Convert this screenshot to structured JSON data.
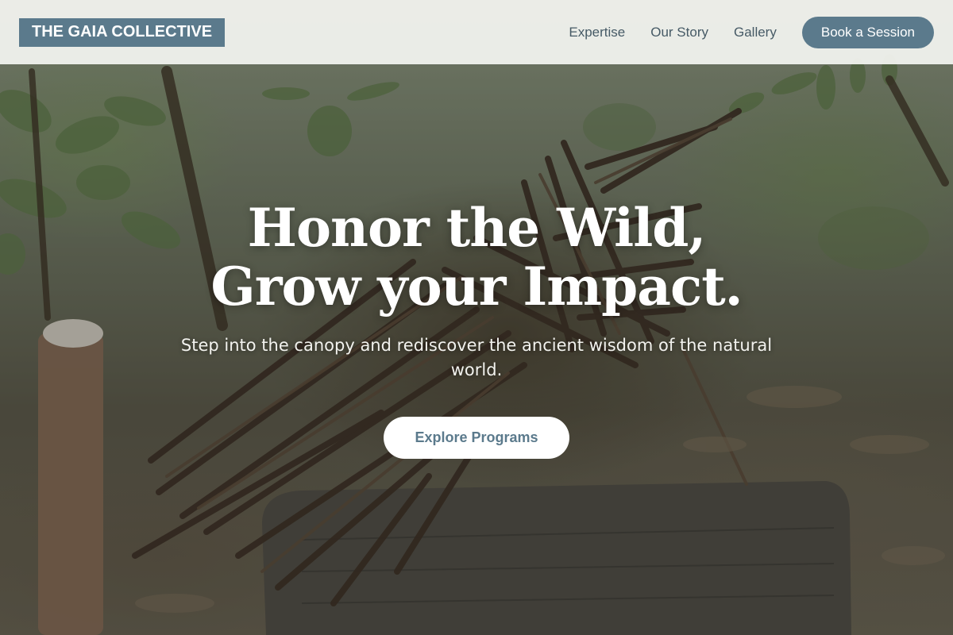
{
  "nav": {
    "logo": "THE GAIA COLLECTIVE",
    "links": [
      "Expertise",
      "Our Story",
      "Gallery"
    ],
    "cta_label": "Book a Session"
  },
  "hero": {
    "headline_line1": "Honor the Wild,",
    "headline_line2": "Grow your Impact.",
    "subtitle": "Step into the canopy and rediscover the ancient wisdom of the natural world.",
    "cta_label": "Explore Programs"
  },
  "colors": {
    "accent": "#5b7a8c",
    "nav_background": "#f1f2ee",
    "nav_text": "#465a66",
    "hero_text": "#ffffff"
  }
}
